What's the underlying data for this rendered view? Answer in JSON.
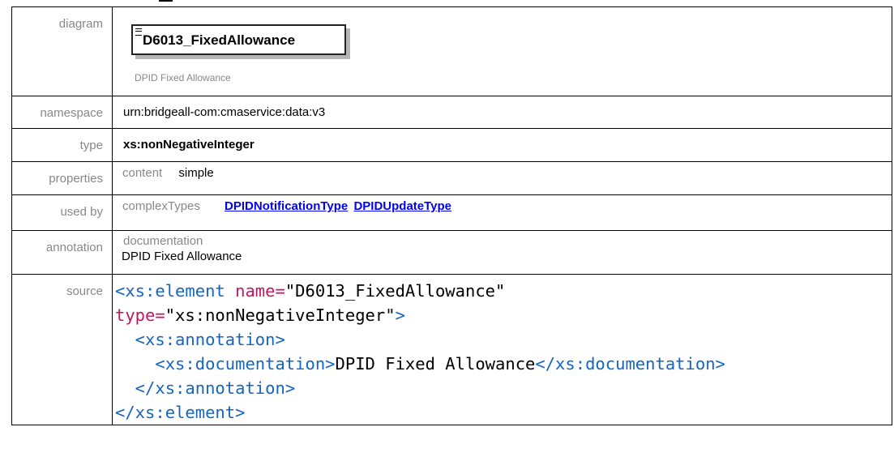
{
  "labels": {
    "diagram": "diagram",
    "namespace": "namespace",
    "type": "type",
    "properties": "properties",
    "used_by": "used by",
    "annotation": "annotation",
    "source": "source"
  },
  "diagram": {
    "element_name": "D6013_FixedAllowance",
    "element_doc": "DPID Fixed Allowance"
  },
  "namespace": "urn:bridgeall-com:cmaservice:data:v3",
  "type": "xs:nonNegativeInteger",
  "properties": {
    "label": "content",
    "value": "simple"
  },
  "used_by": {
    "label": "complexTypes",
    "links": [
      "DPIDNotificationType",
      "DPIDUpdateType"
    ]
  },
  "annotation": {
    "label": "documentation",
    "text": "DPID Fixed Allowance"
  },
  "source": {
    "line1_tag": "<xs:element ",
    "line1_attr": "name=",
    "line1_val": "\"D6013_FixedAllowance\"",
    "line2_attr": "type=",
    "line2_val": "\"xs:nonNegativeInteger\"",
    "line2_close": ">",
    "line3": "  <xs:annotation>",
    "line4_open": "    <xs:documentation>",
    "line4_text": "DPID Fixed Allowance",
    "line4_close": "</xs:documentation>",
    "line5": "  </xs:annotation>",
    "line6": "</xs:element>"
  }
}
